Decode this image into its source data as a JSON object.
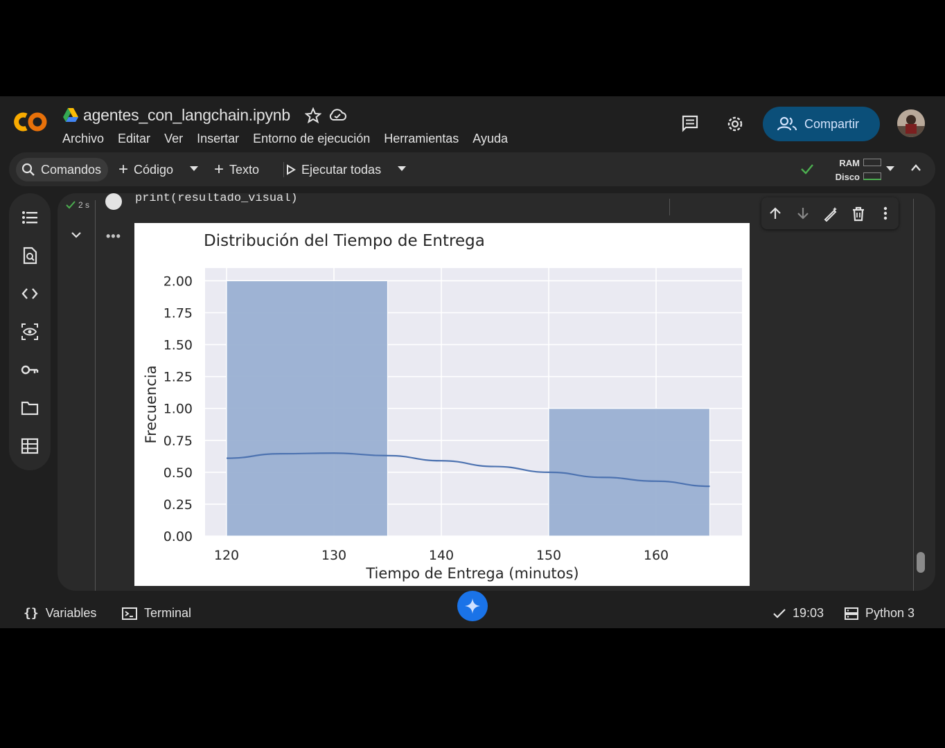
{
  "header": {
    "filename": "agentes_con_langchain.ipynb",
    "menu": [
      "Archivo",
      "Editar",
      "Ver",
      "Insertar",
      "Entorno de ejecución",
      "Herramientas",
      "Ayuda"
    ],
    "share_label": "Compartir"
  },
  "toolbar": {
    "commands_label": "Comandos",
    "code_label": "Código",
    "text_label": "Texto",
    "run_all_label": "Ejecutar todas",
    "ram_label": "RAM",
    "disk_label": "Disco"
  },
  "cell": {
    "exec_time": "2 s",
    "code": "print(resultado_visual)"
  },
  "statusbar": {
    "variables_label": "Variables",
    "terminal_label": "Terminal",
    "time": "19:03",
    "kernel": "Python 3"
  },
  "colors": {
    "accent": "#0b4f79",
    "bar_fill": "#9ab0d2",
    "kde_line": "#4c72b0",
    "plot_bg": "#eaeaf2",
    "check": "#4caf50"
  },
  "chart_data": {
    "type": "bar",
    "title": "Distribución del Tiempo de Entrega",
    "xlabel": "Tiempo de Entrega (minutos)",
    "ylabel": "Frecuencia",
    "xlim": [
      118,
      168
    ],
    "ylim": [
      0,
      2.1
    ],
    "xticks": [
      120,
      130,
      140,
      150,
      160
    ],
    "yticks": [
      "0.00",
      "0.25",
      "0.50",
      "0.75",
      "1.00",
      "1.25",
      "1.50",
      "1.75",
      "2.00"
    ],
    "bins": [
      {
        "start": 120,
        "end": 135,
        "value": 2
      },
      {
        "start": 135,
        "end": 150,
        "value": 0
      },
      {
        "start": 150,
        "end": 165,
        "value": 1
      }
    ],
    "kde": {
      "x": [
        120,
        125,
        130,
        135,
        140,
        145,
        150,
        155,
        160,
        165
      ],
      "y": [
        0.61,
        0.645,
        0.65,
        0.63,
        0.59,
        0.545,
        0.5,
        0.46,
        0.43,
        0.39
      ]
    },
    "grid": true
  }
}
